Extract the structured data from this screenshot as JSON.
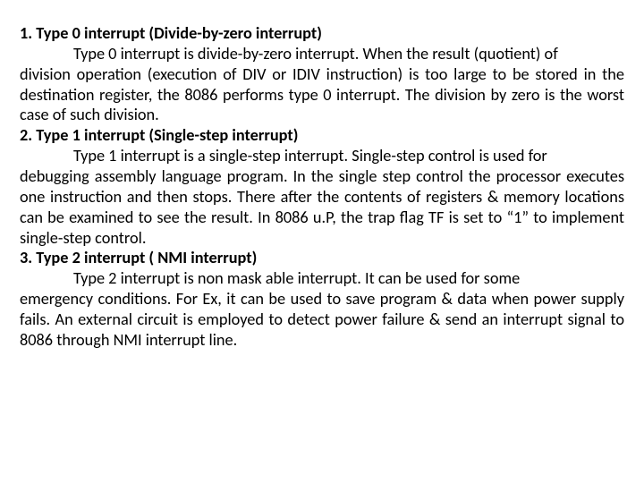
{
  "sections": [
    {
      "heading": "1. Type 0 interrupt (Divide-by-zero interrupt)",
      "lead": "Type 0 interrupt is divide-by-zero interrupt. When the result (quotient) of",
      "rest": "division operation (execution of DIV or IDIV instruction) is too large to be stored in the destination register, the 8086 performs type 0 interrupt. The division by zero is the worst case of such division."
    },
    {
      "heading": "2. Type 1 interrupt (Single-step interrupt)",
      "lead": "Type 1 interrupt is a single-step interrupt. Single-step control is used for",
      "rest": "debugging assembly language program. In the single step control the processor executes one instruction and then stops. There after the contents of registers & memory locations can be examined to see the result. In 8086 u.P, the trap flag TF is set to “1” to implement single-step control."
    },
    {
      "heading": "3. Type 2 interrupt ( NMI interrupt)",
      "lead": "Type 2 interrupt is non mask able interrupt. It can be used for some",
      "rest": "emergency conditions. For Ex, it can be used to save program & data when power supply fails. An external circuit is employed to detect power failure & send an interrupt signal to 8086 through NMI interrupt line."
    }
  ]
}
